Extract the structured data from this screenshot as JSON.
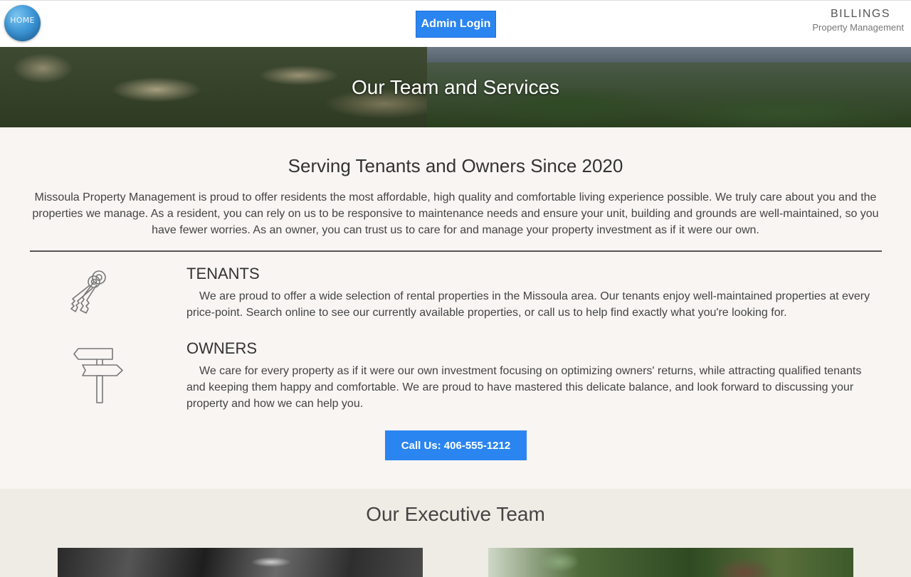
{
  "header": {
    "home_label": "HOME",
    "admin_label": "Admin Login",
    "brand_name": "BILLINGS",
    "brand_sub": "Property Management"
  },
  "hero": {
    "title": "Our Team and Services"
  },
  "intro": {
    "title": "Serving Tenants and Owners Since 2020",
    "text": "Missoula Property Management is proud to offer residents the most affordable, high quality and comfortable living experience possible. We truly care about you and the properties we manage. As a resident, you can rely on us to be responsive to maintenance needs and ensure your unit, building and grounds are well-maintained, so you have fewer worries. As an owner, you can trust us to care for and manage your property investment as if it were our own."
  },
  "features": [
    {
      "icon": "keys-icon",
      "heading": "TENANTS",
      "text": "We are proud to offer a wide selection of rental properties in the Missoula area. Our tenants enjoy well-maintained properties at every price-point. Search online to see our currently available properties, or call us to help find exactly what you're looking for."
    },
    {
      "icon": "signpost-icon",
      "heading": "OWNERS",
      "text": "We care for every property as if it were our own investment focusing on optimizing owners' returns, while attracting qualified tenants and keeping them happy and comfortable. We are proud to have mastered this delicate balance, and look forward to discussing your property and how we can help you."
    }
  ],
  "call": {
    "label": "Call Us: 406-555-1212"
  },
  "team": {
    "title": "Our Executive Team"
  },
  "colors": {
    "accent": "#2b85f0",
    "background": "#f8f5f3",
    "team_background": "#efece5"
  }
}
